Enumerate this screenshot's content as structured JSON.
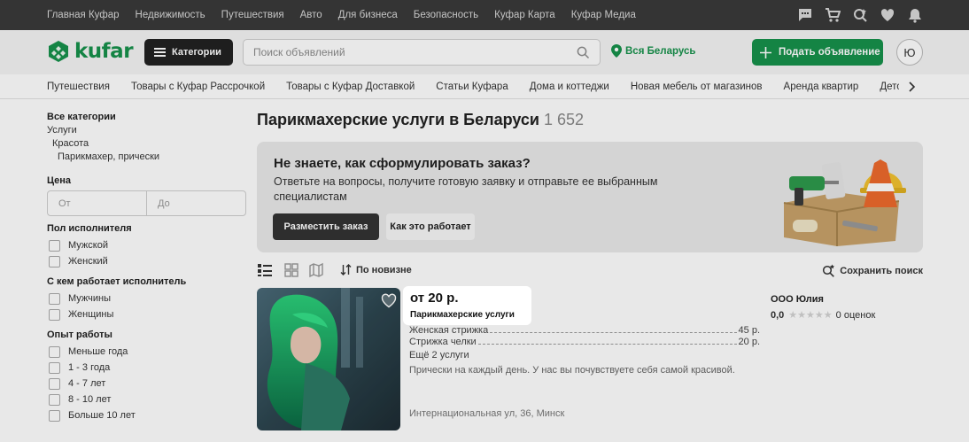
{
  "top_nav": {
    "links": [
      "Главная Куфар",
      "Недвижимость",
      "Путешествия",
      "Авто",
      "Для бизнеса",
      "Безопасность",
      "Куфар Карта",
      "Куфар Медиа"
    ],
    "icons": [
      "chat-icon",
      "cart-icon",
      "saved-search-icon",
      "heart-icon",
      "bell-icon"
    ]
  },
  "header": {
    "logo_text": "kufar",
    "categories_label": "Категории",
    "search_placeholder": "Поиск объявлений",
    "region_label": "Вся Беларусь",
    "post_ad_label": "Подать объявление",
    "avatar_letter": "Ю"
  },
  "category_strip": [
    "Путешествия",
    "Товары с Куфар Рассрочкой",
    "Товары с Куфар Доставкой",
    "Статьи Куфара",
    "Дома и коттеджи",
    "Новая мебель от магазинов",
    "Аренда квартир",
    "Детск"
  ],
  "sidebar": {
    "all_categories": "Все категории",
    "crumbs": [
      "Услуги",
      "Красота",
      "Парикмахер, прически"
    ],
    "price_label": "Цена",
    "price_from": "От",
    "price_to": "До",
    "gender_label": "Пол исполнителя",
    "gender_options": [
      "Мужской",
      "Женский"
    ],
    "works_with_label": "С кем работает исполнитель",
    "works_with_options": [
      "Мужчины",
      "Женщины"
    ],
    "experience_label": "Опыт работы",
    "experience_options": [
      "Меньше года",
      "1 - 3 года",
      "4 - 7 лет",
      "8 - 10 лет",
      "Больше 10 лет"
    ]
  },
  "main": {
    "title": "Парикмахерские услуги в Беларуси",
    "count": "1 652",
    "banner": {
      "heading": "Не знаете, как сформулировать заказ?",
      "text": "Ответьте на вопросы, получите готовую заявку и отправьте ее выбранным специалистам",
      "primary_button": "Разместить заказ",
      "secondary_button": "Как это работает"
    },
    "toolbar": {
      "sort_label": "По новизне",
      "save_search_label": "Сохранить поиск"
    },
    "listing": {
      "price": "от 20 р.",
      "category": "Парикмахерские услуги",
      "services": [
        {
          "name": "Женская стрижка",
          "price": "45 р."
        },
        {
          "name": "Стрижка челки",
          "price": "20 р."
        }
      ],
      "more_services": "Ещё 2 услуги",
      "description": "Прически на каждый день. У нас вы почувствуете себя самой красивой.",
      "address": "Интернациональная ул, 36, Минск",
      "seller": "ООО Юлия",
      "rating_value": "0,0",
      "rating_count": "0 оценок",
      "stars": 0
    }
  },
  "colors": {
    "brand_green": "#16924b",
    "top_bar": "#3a3a3a",
    "dark_button": "#222222"
  }
}
